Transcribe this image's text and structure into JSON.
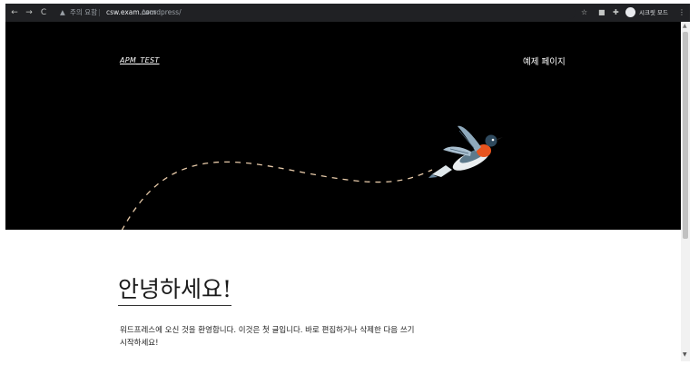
{
  "browser": {
    "back_icon": "←",
    "forward_icon": "→",
    "reload_icon": "C",
    "security_icon": "▲",
    "security_text": "주의 요함",
    "separator": "|",
    "url_host": "csw.exam.com",
    "url_path": "/wordpress/",
    "bookmark_icon": "☆",
    "extension_icon": "■",
    "puzzle_icon": "✚",
    "profile_name": "시크릿 모드",
    "menu_icon": "⋮"
  },
  "site": {
    "title": "APM_TEST",
    "nav": [
      {
        "label": "예제 페이지"
      }
    ]
  },
  "post": {
    "title": "안녕하세요!",
    "body": "워드프레스에 오신 것을 환영합니다. 이것은 첫 글입니다. 바로 편집하거나 삭제한 다음 쓰기 시작하세요!"
  },
  "scrollbar": {
    "up_icon": "▲",
    "down_icon": "▼"
  },
  "colors": {
    "chrome_bg": "#202124",
    "hero_bg": "#000000",
    "dash_path": "#e6c9a8",
    "bird_breast": "#e8541e"
  }
}
